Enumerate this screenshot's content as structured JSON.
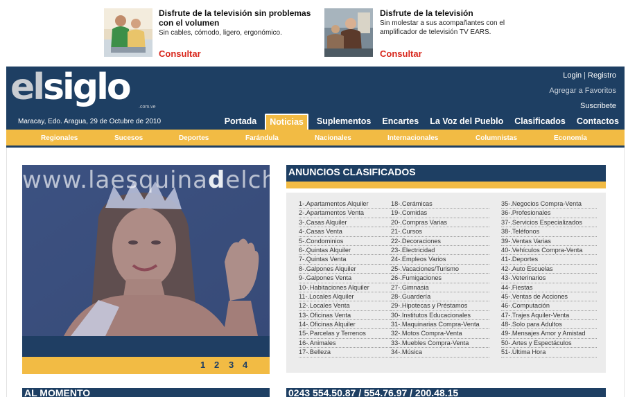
{
  "ads": [
    {
      "title": "Disfrute de la televisión sin problemas con el volumen",
      "description": "Sin cables, cómodo, ligero, ergonómico.",
      "cta": "Consultar"
    },
    {
      "title": "Disfrute de la televisión",
      "description": "Sin molestar a sus acompañantes con el amplificador de televisión TV EARS.",
      "cta": "Consultar"
    }
  ],
  "header": {
    "logo_el": "el",
    "logo_siglo": "siglo",
    "logo_domain": ".com.ve",
    "dateline": "Maracay, Edo. Aragua, 29 de Octubre de 2010",
    "login": "Login",
    "separator": "|",
    "register": "Registro",
    "favorites": "Agregar a Favoritos",
    "subscribe": "Suscribete"
  },
  "main_nav": [
    "Portada",
    "Noticias",
    "Suplementos",
    "Encartes",
    "La Voz del Pueblo",
    "Clasificados",
    "Contactos"
  ],
  "active_tab": "Noticias",
  "sub_nav": [
    "Regionales",
    "Sucesos",
    "Deportes",
    "Farándula",
    "Nacionales",
    "Internacionales",
    "Columnistas",
    "Economía"
  ],
  "slideshow": {
    "watermark_pre": "www.laesquina",
    "watermark_bold": "d",
    "watermark_post": "elchisme.net",
    "pages": [
      "1",
      "2",
      "3",
      "4"
    ]
  },
  "classifieds": {
    "title": "ANUNCIOS CLASIFICADOS",
    "columns": [
      [
        "1-.Apartamentos Alquiler",
        "2-.Apartamentos Venta",
        "3-.Casas Alquiler",
        "4-.Casas Venta",
        "5-.Condominios",
        "6-.Quintas Alquiler",
        "7-.Quintas Venta",
        "8-.Galpones Alquiler",
        "9-.Galpones Venta",
        "10-.Habitaciones Alquiler",
        "11-.Locales Alquiler",
        "12-.Locales Venta",
        "13-.Oficinas Venta",
        "14-.Oficinas Alquiler",
        "15-.Parcelas y Terrenos",
        "16-.Animales",
        "17-.Belleza"
      ],
      [
        "18-.Cerámicas",
        "19-.Comidas",
        "20-.Compras Varias",
        "21-.Cursos",
        "22-.Decoraciones",
        "23-.Electricidad",
        "24-.Empleos Varios",
        "25-.Vacaciones/Turismo",
        "26-.Fumigaciones",
        "27-.Gimnasia",
        "28-.Guardería",
        "29-.Hipotecas y Préstamos",
        "30-.Institutos Educacionales",
        "31-.Maquinarias Compra-Venta",
        "32-.Motos Compra-Venta",
        "33-.Muebles Compra-Venta",
        "34-.Música"
      ],
      [
        "35-.Negocios Compra-Venta",
        "36-.Profesionales",
        "37-.Servicios Especializados",
        "38-.Teléfonos",
        "39-.Ventas Varias",
        "40-.Vehículos Compra-Venta",
        "41-.Deportes",
        "42-.Auto Escuelas",
        "43-.Veterinarios",
        "44-.Fiestas",
        "45-.Ventas de Acciones",
        "46-.Computación",
        "47-.Trajes Aquiler-Venta",
        "48-.Solo para Adultos",
        "49-.Mensajes Amor y Amistad",
        "50-.Artes y Espectáculos",
        "51-.Última Hora"
      ]
    ]
  },
  "al_momento": "AL MOMENTO",
  "phones": "0243 554.50.87 / 554.76.97 / 200.48.15",
  "colors": {
    "navy": "#1e3f63",
    "gold": "#f2bb44",
    "cta_red": "#d8271c"
  }
}
